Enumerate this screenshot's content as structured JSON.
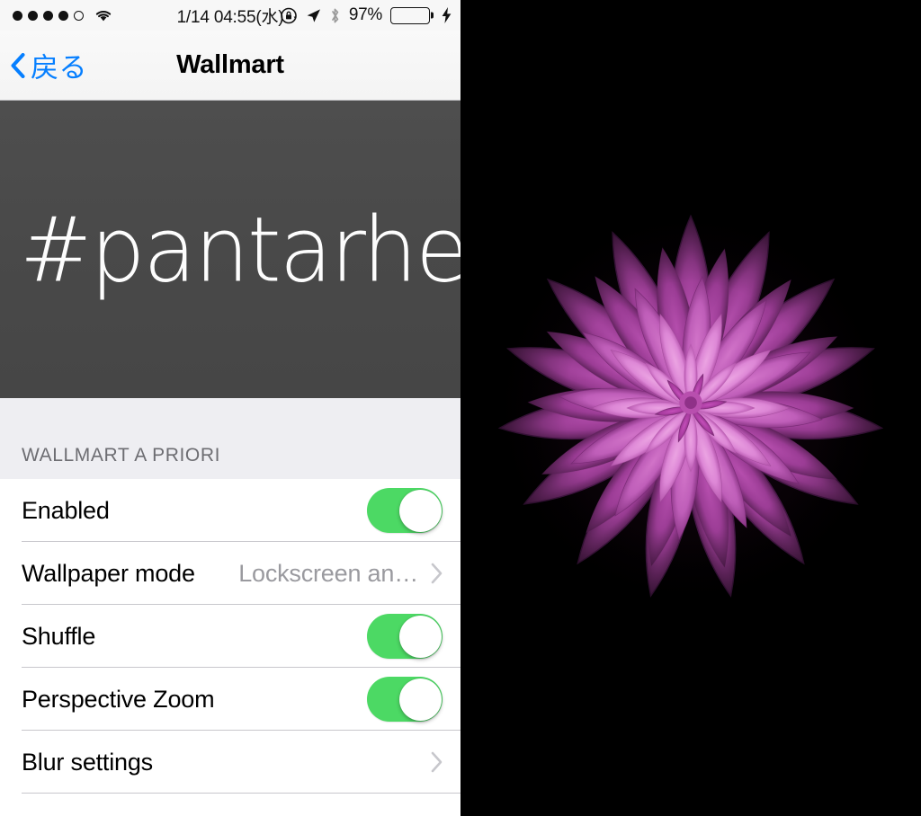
{
  "status_bar": {
    "signal_dots_filled": 4,
    "signal_dots_total": 5,
    "wifi_icon": "wifi-icon",
    "datetime": "1/14 04:55(水)",
    "rotation_lock_icon": "rotation-lock-icon",
    "location_icon": "location-arrow-icon",
    "bluetooth_icon": "bluetooth-icon",
    "battery_percent": "97%",
    "battery_level": 97,
    "battery_color": "#4cd964",
    "charging_icon": "lightning-bolt-icon"
  },
  "nav_bar": {
    "back_icon": "chevron-left-icon",
    "back_label": "戻る",
    "title": "Wallmart"
  },
  "banner": {
    "text": "#pantarhei",
    "background_color": "#494949",
    "text_color": "#fdfdfd"
  },
  "section": {
    "header": "WALLMART A PRIORI",
    "rows": [
      {
        "label": "Enabled",
        "type": "switch",
        "value": "on",
        "accent": "#4cd964"
      },
      {
        "label": "Wallpaper mode",
        "type": "disclosure",
        "value": "Lockscreen an…",
        "chevron_icon": "chevron-right-icon"
      },
      {
        "label": "Shuffle",
        "type": "switch",
        "value": "on",
        "accent": "#4cd964"
      },
      {
        "label": "Perspective Zoom",
        "type": "switch",
        "value": "on",
        "accent": "#4cd964"
      },
      {
        "label": "Blur settings",
        "type": "disclosure",
        "value": "",
        "chevron_icon": "chevron-right-icon"
      }
    ]
  },
  "wallpaper_preview": {
    "name": "purple-dahlia-flower-wallpaper",
    "background_color": "#000000",
    "petal_color_outer": "#9c3d96",
    "petal_color_mid": "#c05fba",
    "petal_color_inner": "#dd87d6",
    "center_color": "#b23fa8"
  }
}
